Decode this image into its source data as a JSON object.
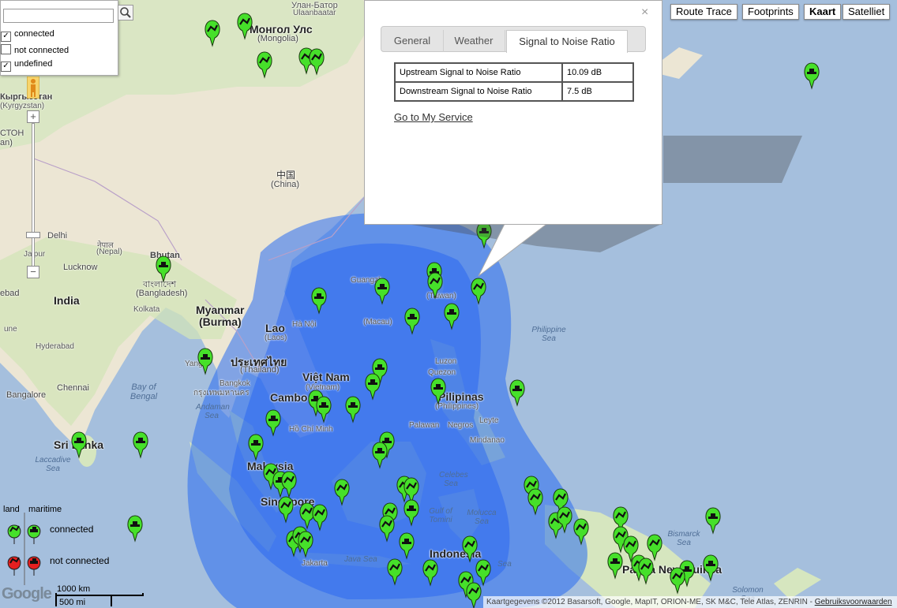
{
  "search": {
    "value": "",
    "button_icon": "magnifier"
  },
  "filters": [
    {
      "label": "connected",
      "checked": true
    },
    {
      "label": "not connected",
      "checked": false
    },
    {
      "label": "undefined",
      "checked": true
    }
  ],
  "map_types": [
    "Route Trace",
    "Footprints",
    "Kaart",
    "Satelliet"
  ],
  "map_type_selected": "Kaart",
  "zoom": {
    "in": "+",
    "out": "−"
  },
  "info_window": {
    "close": "×",
    "tabs": [
      "General",
      "Weather",
      "Signal to Noise Ratio"
    ],
    "active_tab": "Signal to Noise Ratio",
    "rows": [
      {
        "label": "Upstream Signal to Noise Ratio",
        "value": "10.09 dB"
      },
      {
        "label": "Downstream Signal to Noise Ratio",
        "value": "7.5 dB"
      }
    ],
    "link": "Go to My Service"
  },
  "legend": {
    "col_land": "land",
    "col_maritime": "maritime",
    "connected": "connected",
    "not_connected": "not connected",
    "colors": {
      "connected": "#46e02a",
      "not_connected": "#e52020"
    }
  },
  "map_labels": {
    "mongolia": "Монгол Улс",
    "mongolia_sub": "(Mongolia)",
    "ulan_bator": "Улан-Батор",
    "ulan_bator_sub": "Ulaanbaatar",
    "china": "中国",
    "china_sub": "(China)",
    "kyrgyzstan": "Кыргызстан",
    "kyrgyzstan_sub": "(Kyrgyzstan)",
    "tajik": "СТОН",
    "tajik_sub": "an)",
    "bhutan": "Bhutan",
    "nepal": "नेपाल",
    "nepal_sub": "(Nepal)",
    "delhi": "Delhi",
    "jaipur": "Jaipur",
    "lucknow": "Lucknow",
    "bangladesh": "বাংলাদেশ",
    "bangladesh_sub": "(Bangladesh)",
    "india": "India",
    "kolkata": "Kolkata",
    "myanmar": "Myanmar",
    "myanmar_sub": "(Burma)",
    "lao": "Lao",
    "lao_sub": "(Laos)",
    "ha_noi": "Hà Nội",
    "guangzhou": "Guangzh",
    "taiwan": "(Taiwan)",
    "macau": "(Macau)",
    "thailand": "ประเทศไทย",
    "thailand_sub": "(Thailand)",
    "yangon": "Yango",
    "bangkok": "Bangkok",
    "bangkok_th": "กรุงเทพมหานคร",
    "vietnam": "Việt Nam",
    "vietnam_sub": "(Vietnam)",
    "cambodia": "Cambo",
    "ho_chi_minh": "Hồ Chí Minh",
    "hyderabad": "Hyderabad",
    "bangalore": "Bangalore",
    "chennai": "Chennai",
    "ebad": "ebad",
    "pune": "une",
    "sri_lanka": "Sri Lanka",
    "bay_of_bengal": "Bay of Bengal",
    "andaman_sea": "Andaman Sea",
    "laccadive_sea": "Laccadive Sea",
    "malaysia": "Malaysia",
    "singapore": "Singapore",
    "luzon": "Luzon",
    "quezon": "Quezon",
    "philippines": "Pilipinas",
    "philippines_sub": "(Philippines)",
    "philippine_sea": "Philippine Sea",
    "palawan": "Palawan",
    "negros": "Negros",
    "leyte": "Leyte",
    "mindanao": "Mindanao",
    "celebes_sea": "Celebes Sea",
    "gulf_tomini": "Gulf of Tomini",
    "molucca_sea": "Molucca Sea",
    "indonesia": "Indonesia",
    "java_sea": "Java Sea",
    "jakarta": "Jakarta",
    "banda_sea": "Sea",
    "papua_new_guinea": "Papua New Guinea",
    "bismarck_sea": "Bismarck Sea",
    "solomon_sea": "Solomon Sea"
  },
  "scale": {
    "km": "1000 km",
    "mi": "500 mi"
  },
  "logo_text": "Google",
  "attribution": "Kaartgegevens ©2012 Basarsoft, Google, MapIT, ORION-ME, SK M&C, Tele Atlas, ZENRIN -",
  "attribution_link": "Gebruiksvoorwaarden"
}
